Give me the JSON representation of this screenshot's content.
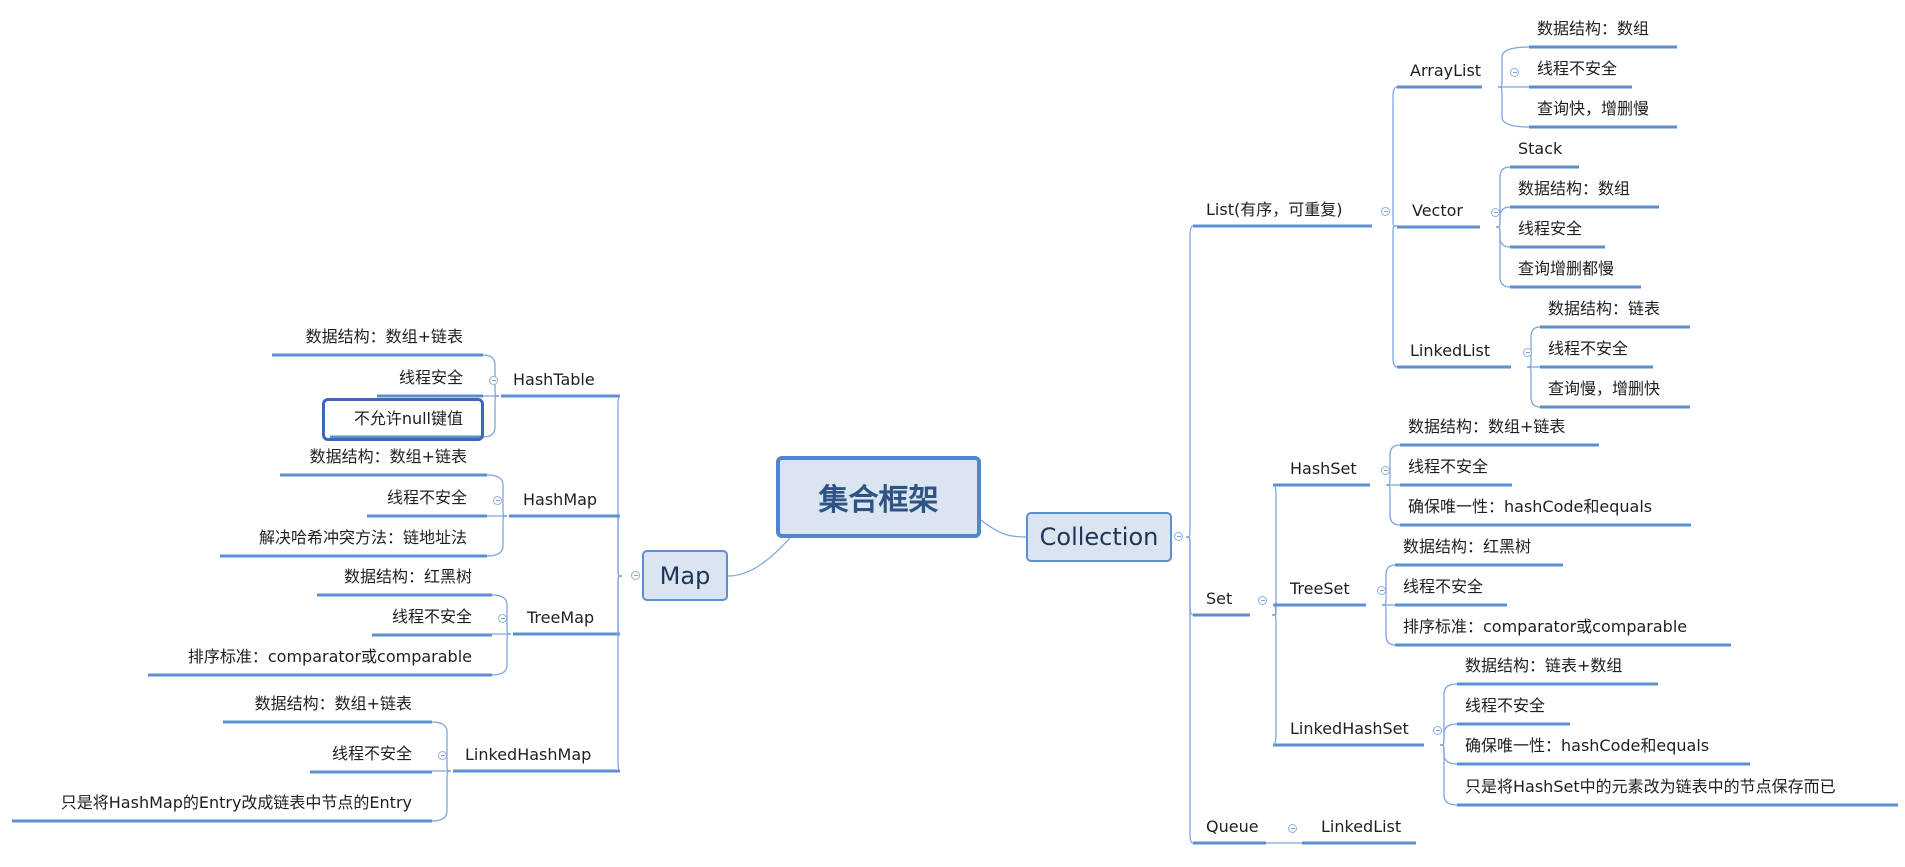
{
  "root": {
    "label": "集合框架"
  },
  "colors": {
    "line": "#5b8fd2",
    "thin_line": "#7fa6dd",
    "node_fill": "#dbe5f2",
    "node_border": "#5b8fd2",
    "selected_border": "#3e67b8"
  },
  "map": {
    "label": "Map",
    "children": [
      {
        "label": "HashTable",
        "children": [
          "数据结构：数组+链表",
          "线程安全",
          "不允许null键值"
        ],
        "selected_child": 2
      },
      {
        "label": "HashMap",
        "children": [
          "数据结构：数组+链表",
          "线程不安全",
          "解决哈希冲突方法：链地址法"
        ]
      },
      {
        "label": "TreeMap",
        "children": [
          "数据结构：红黑树",
          "线程不安全",
          "排序标准：comparator或comparable"
        ]
      },
      {
        "label": "LinkedHashMap",
        "children": [
          "数据结构：数组+链表",
          "线程不安全",
          "只是将HashMap的Entry改成链表中节点的Entry"
        ]
      }
    ]
  },
  "collection": {
    "label": "Collection",
    "children": [
      {
        "label": "List(有序，可重复)",
        "children": [
          {
            "label": "ArrayList",
            "children": [
              "数据结构：数组",
              "线程不安全",
              "查询快，增删慢"
            ]
          },
          {
            "label": "Vector",
            "children": [
              "Stack",
              "数据结构：数组",
              "线程安全",
              "查询增删都慢"
            ]
          },
          {
            "label": "LinkedList",
            "children": [
              "数据结构：链表",
              "线程不安全",
              "查询慢，增删快"
            ]
          }
        ]
      },
      {
        "label": "Set",
        "children": [
          {
            "label": "HashSet",
            "children": [
              "数据结构：数组+链表",
              "线程不安全",
              "确保唯一性：hashCode和equals"
            ]
          },
          {
            "label": "TreeSet",
            "children": [
              "数据结构：红黑树",
              "线程不安全",
              "排序标准：comparator或comparable"
            ]
          },
          {
            "label": "LinkedHashSet",
            "children": [
              "数据结构：链表+数组",
              "线程不安全",
              "确保唯一性：hashCode和equals",
              "只是将HashSet中的元素改为链表中的节点保存而已"
            ]
          }
        ]
      },
      {
        "label": "Queue",
        "children": [
          {
            "label": "LinkedList",
            "children": []
          }
        ]
      }
    ]
  }
}
